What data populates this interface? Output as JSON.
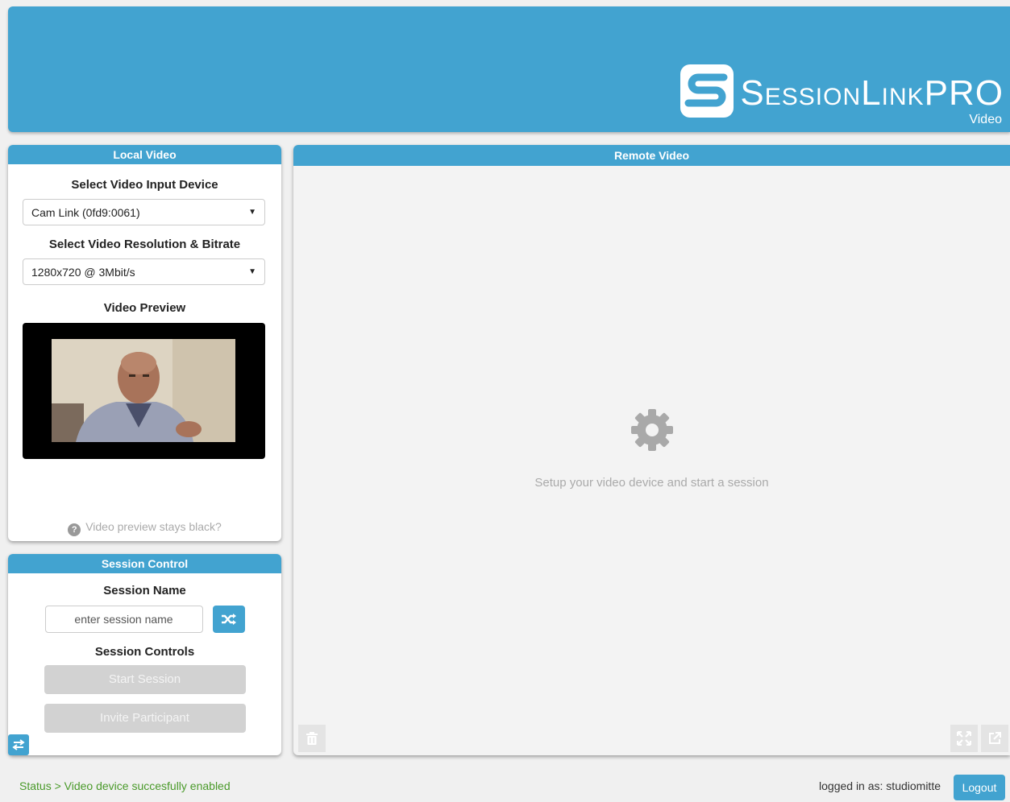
{
  "header": {
    "logo_s": "S",
    "logo_ession": "ESSION",
    "logo_l": "L",
    "logo_ink": "INK",
    "logo_pro": "PRO",
    "logo_sub": "Video"
  },
  "local_video": {
    "title": "Local Video",
    "device_label": "Select Video Input Device",
    "device_value": "Cam Link (0fd9:0061)",
    "resolution_label": "Select Video Resolution & Bitrate",
    "resolution_value": "1280x720 @ 3Mbit/s",
    "preview_label": "Video Preview",
    "help_text": "Video preview stays black?"
  },
  "session_control": {
    "title": "Session Control",
    "name_label": "Session Name",
    "name_placeholder": "enter session name",
    "controls_label": "Session Controls",
    "start_label": "Start Session",
    "invite_label": "Invite Participant"
  },
  "remote_video": {
    "title": "Remote Video",
    "message": "Setup your video device and start a session"
  },
  "footer": {
    "status": "Status > Video device succesfully enabled",
    "user_text": "logged in as: studiomitte",
    "logout_label": "Logout"
  },
  "colors": {
    "accent": "#42a3d0",
    "status_green": "#4a9a2a",
    "disabled": "#d2d2d2"
  },
  "icons": [
    "help-icon",
    "shuffle-icon",
    "swap-icon",
    "gear-icon",
    "trash-icon",
    "fullscreen-icon",
    "popout-icon",
    "dropdown-caret-icon"
  ]
}
